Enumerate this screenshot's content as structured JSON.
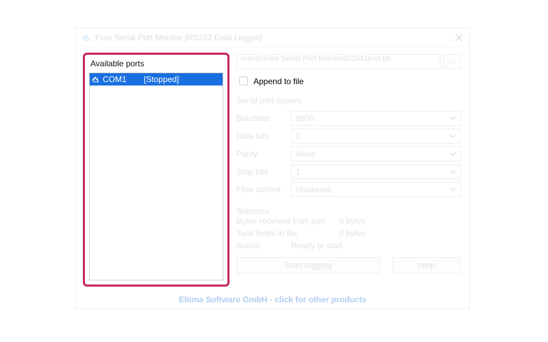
{
  "window": {
    "title": "Free Serial Port Monitor [RS232 Data Logger]"
  },
  "ports_panel": {
    "header": "Available ports",
    "items": [
      {
        "name": "COM1",
        "status": "[Stopped]"
      }
    ]
  },
  "file": {
    "path": "ments\\Free Serial Port Monitor\\COM1port.txt",
    "browse_label": "...",
    "append_label": "Append to file"
  },
  "options": {
    "group_label": "Serial port options",
    "baudrate": {
      "label": "Baudrate",
      "value": "9600"
    },
    "data_bits": {
      "label": "Data bits",
      "value": "8"
    },
    "parity": {
      "label": "Parity",
      "value": "None"
    },
    "stop_bits": {
      "label": "Stop bits",
      "value": "1"
    },
    "flow_control": {
      "label": "Flow control",
      "value": "Hardware"
    }
  },
  "stats": {
    "group_label": "Statistics",
    "bytes_port": {
      "label": "Bytes received from port",
      "value": "0 bytes"
    },
    "bytes_file": {
      "label": "Total bytes in file",
      "value": "0 bytes"
    },
    "status": {
      "label": "Status",
      "value": "Ready to start"
    }
  },
  "buttons": {
    "start": "Start logging",
    "help": "Help"
  },
  "footer": {
    "link_text": "Eltima Software GmbH - click for other products"
  }
}
